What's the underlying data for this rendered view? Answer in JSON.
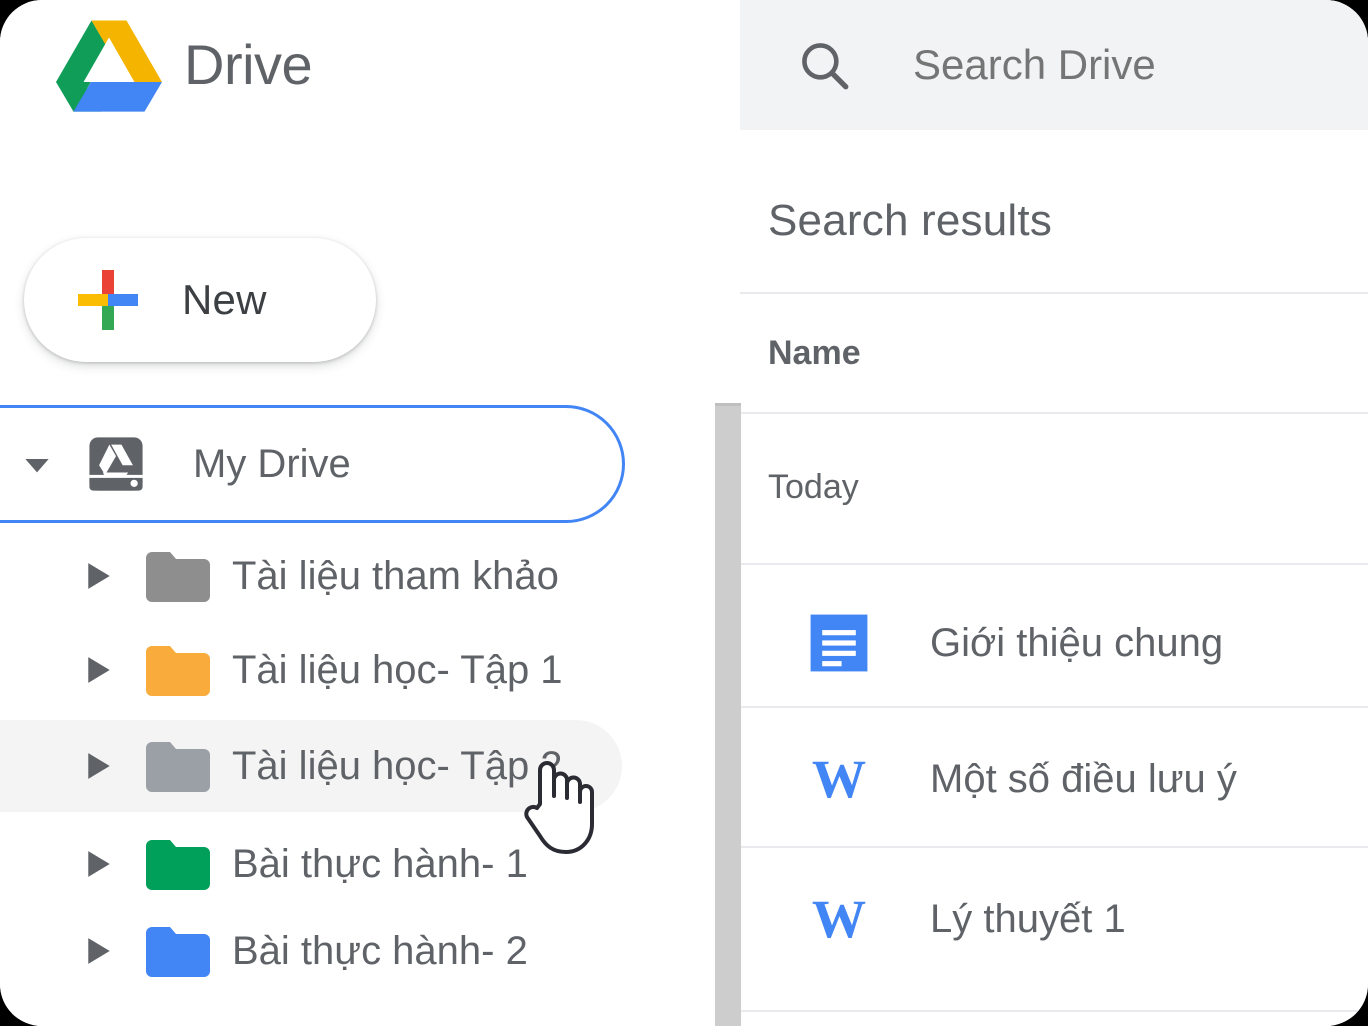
{
  "brand": {
    "wordmark": "Drive",
    "logo_icon": "google-drive-triangle-logo",
    "colors": {
      "green": "#0F9D58",
      "yellow": "#F4B400",
      "blue": "#4285F4"
    }
  },
  "sidebar": {
    "new_button": {
      "label": "New",
      "icon": "multicolor-plus-icon",
      "plus_colors": {
        "top": "#EA4335",
        "left": "#FBBC04",
        "right": "#4285F4",
        "bottom": "#34A853"
      }
    },
    "my_drive": {
      "label": "My Drive",
      "icon": "drive-hard-disk-icon",
      "caret": "chevron-down-icon",
      "expanded": true,
      "focused": true,
      "focus_color": "#4285F4"
    },
    "folders": [
      {
        "label": "Tài liệu tham khảo",
        "color": "#8E8E8E",
        "caret": "chevron-right-icon",
        "hovered": false
      },
      {
        "label": "Tài liệu học- Tập 1",
        "color": "#F9AB3C",
        "caret": "chevron-right-icon",
        "hovered": false
      },
      {
        "label": "Tài liệu học- Tập 2",
        "color": "#9AA0A6",
        "caret": "chevron-right-icon",
        "hovered": true
      },
      {
        "label": "Bài thực hành- 1",
        "color": "#00A05A",
        "caret": "chevron-right-icon",
        "hovered": false
      },
      {
        "label": "Bài thực hành- 2",
        "color": "#4285F4",
        "caret": "chevron-right-icon",
        "hovered": false
      }
    ]
  },
  "search": {
    "placeholder": "Search Drive",
    "value": "",
    "icon": "search-icon",
    "background": "#F1F3F4"
  },
  "results": {
    "heading": "Search results",
    "columns": [
      "Name"
    ],
    "group_label": "Today",
    "items": [
      {
        "name": "Giới thiệu chung",
        "icon": "google-docs-icon",
        "icon_color": "#4285F4"
      },
      {
        "name": "Một số điều lưu ý",
        "icon": "word-doc-icon",
        "icon_color": "#4285F4"
      },
      {
        "name": "Lý thuyết 1",
        "icon": "word-doc-icon",
        "icon_color": "#4285F4"
      }
    ]
  },
  "cursor": {
    "type": "pointing-hand-cursor"
  }
}
